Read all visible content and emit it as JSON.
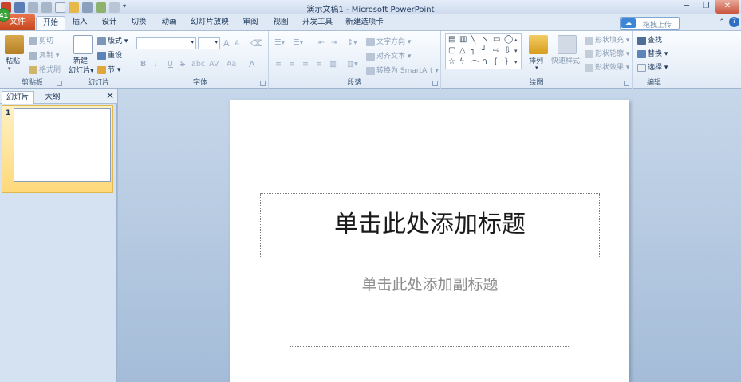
{
  "window": {
    "title": "演示文稿1 - Microsoft PowerPoint",
    "badge": "41"
  },
  "tabs": {
    "file": "文件",
    "items": [
      "开始",
      "插入",
      "设计",
      "切换",
      "动画",
      "幻灯片放映",
      "审阅",
      "视图",
      "开发工具",
      "新建选项卡"
    ],
    "active": "开始"
  },
  "upload_button": "拖拽上传",
  "ribbon": {
    "clipboard": {
      "label": "剪贴板",
      "paste": "粘贴",
      "cut": "剪切",
      "copy": "复制",
      "format_painter": "格式刷"
    },
    "slides": {
      "label": "幻灯片",
      "new_slide_1": "新建",
      "new_slide_2": "幻灯片",
      "layout": "版式",
      "reset": "重设",
      "section": "节"
    },
    "font": {
      "label": "字体",
      "bold": "B",
      "italic": "I",
      "underline": "U",
      "strike": "S",
      "shadow": "abc",
      "spacing": "AV",
      "case": "Aa",
      "color": "A",
      "grow": "A",
      "shrink": "A"
    },
    "paragraph": {
      "label": "段落",
      "text_direction": "文字方向",
      "align_text": "对齐文本",
      "smartart": "转换为 SmartArt"
    },
    "drawing": {
      "label": "绘图",
      "arrange": "排列",
      "quick_styles": "快速样式",
      "shape_fill": "形状填充",
      "shape_outline": "形状轮廓",
      "shape_effects": "形状效果"
    },
    "editing": {
      "label": "编辑",
      "find": "查找",
      "replace": "替换",
      "select": "选择"
    }
  },
  "left_pane": {
    "tabs": [
      "幻灯片",
      "大纲"
    ],
    "active": "幻灯片",
    "close": "✕",
    "slide_number": "1"
  },
  "slide": {
    "title_placeholder": "单击此处添加标题",
    "subtitle_placeholder": "单击此处添加副标题"
  },
  "colors": {
    "file_tab": "#c6451c",
    "accent_blue": "#2f6fc4",
    "selection": "#ffd97a"
  }
}
